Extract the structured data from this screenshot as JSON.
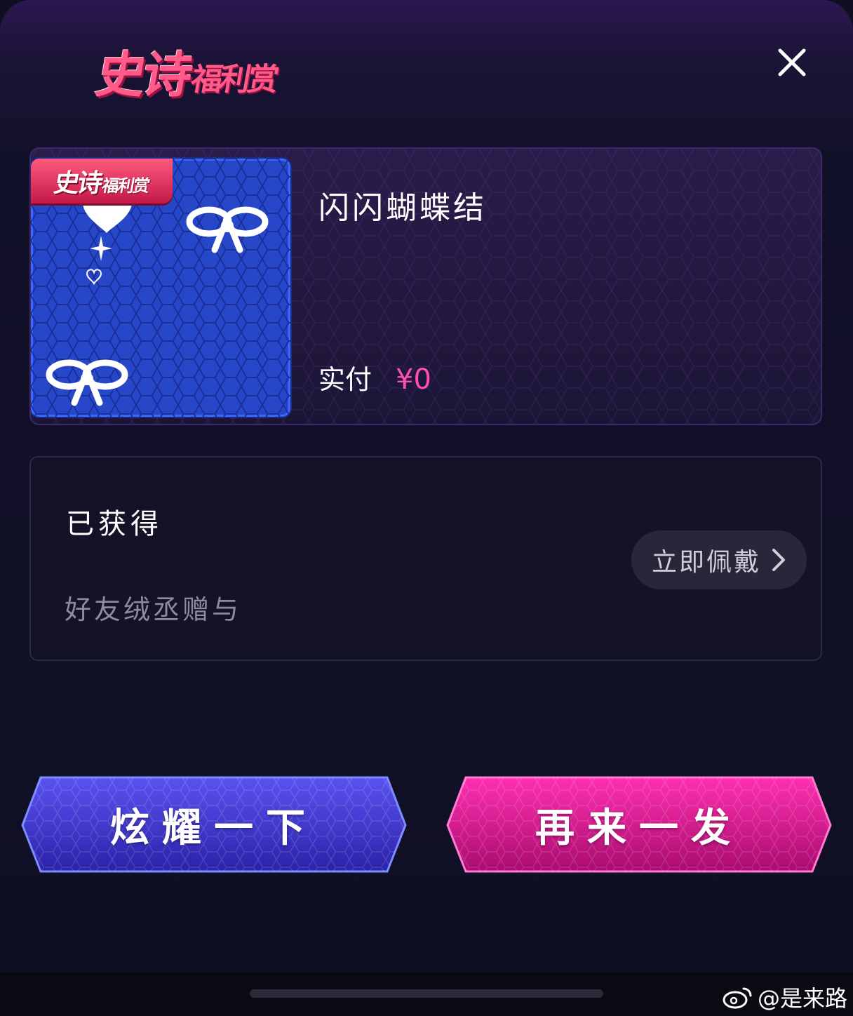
{
  "header": {
    "logo_big": "史诗",
    "logo_small": "福利赏",
    "close_icon": "close-icon"
  },
  "item": {
    "badge_big": "史诗",
    "badge_small": "福利赏",
    "name": "闪闪蝴蝶结",
    "pay_label": "实付",
    "pay_amount": "¥0"
  },
  "obtain": {
    "status": "已获得",
    "source": "好友绒丞赠与",
    "wear_button": "立即佩戴"
  },
  "actions": {
    "show_off": "炫耀一下",
    "again": "再来一发"
  },
  "watermark": {
    "text": "@是来路",
    "icon": "weibo-icon"
  },
  "colors": {
    "accent_pink": "#ff4fb3",
    "button_blue": "#4a3fe0",
    "button_pink": "#e0148f"
  }
}
